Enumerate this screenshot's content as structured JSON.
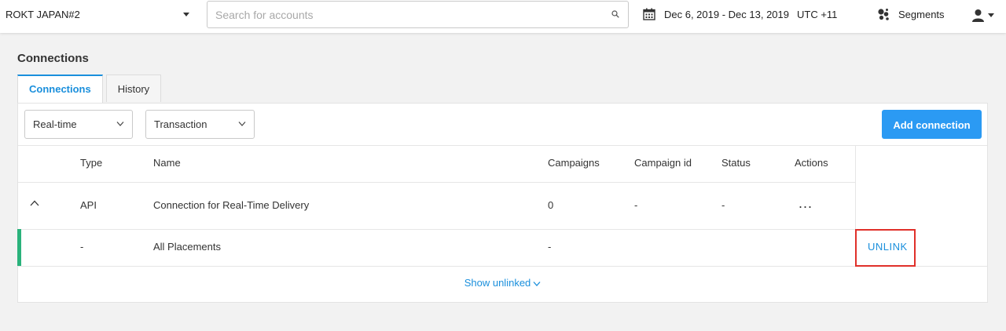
{
  "header": {
    "account_name": "ROKT JAPAN#2",
    "search": {
      "placeholder": "Search for accounts",
      "value": ""
    },
    "date_range": "Dec 6, 2019 - Dec 13, 2019",
    "timezone": "UTC +11",
    "segments_label": "Segments"
  },
  "page": {
    "title": "Connections"
  },
  "tabs": [
    {
      "label": "Connections",
      "active": true
    },
    {
      "label": "History",
      "active": false
    }
  ],
  "filters": {
    "mode": "Real-time",
    "event": "Transaction",
    "add_button": "Add connection"
  },
  "table": {
    "columns": [
      "Type",
      "Name",
      "Campaigns",
      "Campaign id",
      "Status",
      "Actions"
    ],
    "connection_row": {
      "type": "API",
      "name": "Connection for Real-Time Delivery",
      "campaigns": "0",
      "campaign_id": "-",
      "status": "-",
      "actions": "..."
    },
    "placement_row": {
      "type": "-",
      "name": "All Placements",
      "campaigns": "-",
      "action": "UNLINK",
      "indicator_color": "#2ab27b"
    },
    "show_unlinked": "Show unlinked"
  },
  "colors": {
    "accent": "#1a8fdc",
    "primary_button": "#2b9af3",
    "highlight_box": "#e0302a"
  },
  "icons": [
    "caret-down-icon",
    "search-icon",
    "calendar-icon",
    "segments-icon",
    "user-icon",
    "chevron-down-icon",
    "chevron-up-icon"
  ]
}
